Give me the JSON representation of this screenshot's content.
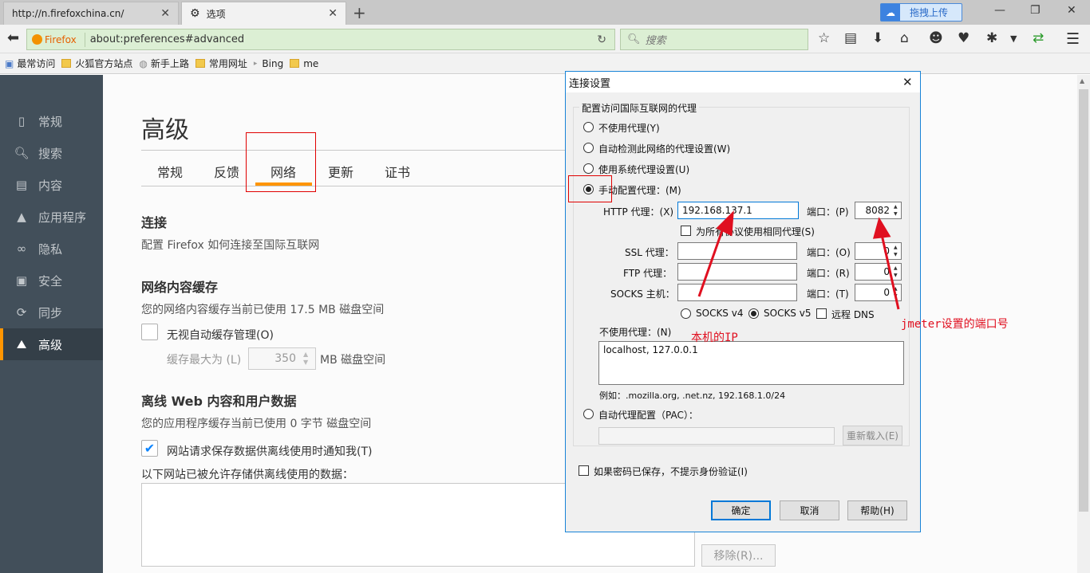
{
  "tabs": [
    {
      "title": "http://n.firefoxchina.cn/"
    },
    {
      "title": "选项"
    }
  ],
  "upload_button": "拖拽上传",
  "url": {
    "brand": "Firefox",
    "address": "about:preferences#advanced",
    "search_placeholder": "搜索"
  },
  "bookmarks": [
    "最常访问",
    "火狐官方站点",
    "新手上路",
    "常用网址",
    "Bing",
    "me"
  ],
  "sidebar": [
    {
      "label": "常规",
      "icon": "general-icon"
    },
    {
      "label": "搜索",
      "icon": "search-icon"
    },
    {
      "label": "内容",
      "icon": "document-icon"
    },
    {
      "label": "应用程序",
      "icon": "rocket-icon"
    },
    {
      "label": "隐私",
      "icon": "mask-icon"
    },
    {
      "label": "安全",
      "icon": "lock-icon"
    },
    {
      "label": "同步",
      "icon": "sync-icon"
    },
    {
      "label": "高级",
      "icon": "wizard-hat-icon"
    }
  ],
  "page": {
    "title": "高级",
    "tabs": [
      "常规",
      "反馈",
      "网络",
      "更新",
      "证书"
    ],
    "connection_heading": "连接",
    "connection_text": "配置 Firefox 如何连接至国际互联网",
    "cache_heading": "网络内容缓存",
    "cache_text": "您的网络内容缓存当前已使用 17.5 MB 磁盘空间",
    "cache_override_label": "无视自动缓存管理(O)",
    "cache_limit_label": "缓存最大为 (L)",
    "cache_limit_value": "350",
    "cache_limit_unit": "MB 磁盘空间",
    "offline_heading": "离线 Web 内容和用户数据",
    "offline_text": "您的应用程序缓存当前已使用 0 字节 磁盘空间",
    "offline_notify_label": "网站请求保存数据供离线使用时通知我(T)",
    "offline_list_label": "以下网站已被允许存储供离线使用的数据：",
    "remove_button": "移除(R)..."
  },
  "dialog": {
    "title": "连接设置",
    "group_label": "配置访问国际互联网的代理",
    "options": [
      "不使用代理(Y)",
      "自动检测此网络的代理设置(W)",
      "使用系统代理设置(U)",
      "手动配置代理：(M)"
    ],
    "http_label": "HTTP 代理：(X)",
    "http_value": "192.168.137.1",
    "port_label_p": "端口：(P)",
    "http_port": "8082",
    "same_proxy_label": "为所有协议使用相同代理(S)",
    "ssl_label": "SSL 代理：",
    "port_label_o": "端口：(O)",
    "ssl_port": "0",
    "ftp_label": "FTP 代理：",
    "port_label_r": "端口：(R)",
    "ftp_port": "0",
    "socks_label": "SOCKS 主机：",
    "port_label_t": "端口：(T)",
    "socks_port": "0",
    "socks4": "SOCKS v4",
    "socks5": "SOCKS v5",
    "remote_dns": "远程 DNS",
    "no_proxy_label": "不使用代理：(N)",
    "no_proxy_value": "localhost, 127.0.0.1",
    "example": "例如：.mozilla.org, .net.nz, 192.168.1.0/24",
    "pac_label": "自动代理配置（PAC）：",
    "reload_button": "重新载入(E)",
    "no_auth_prompt": "如果密码已保存，不提示身份验证(I)",
    "ok": "确定",
    "cancel": "取消",
    "help": "帮助(H)"
  },
  "annotations": {
    "ip_note": "本机的IP",
    "port_note": "jmeter设置的端口号"
  },
  "colors": {
    "accent": "#ff9500",
    "sidebar": "#424f5a",
    "annotation": "#e01020",
    "dialog_border": "#1883d7"
  }
}
